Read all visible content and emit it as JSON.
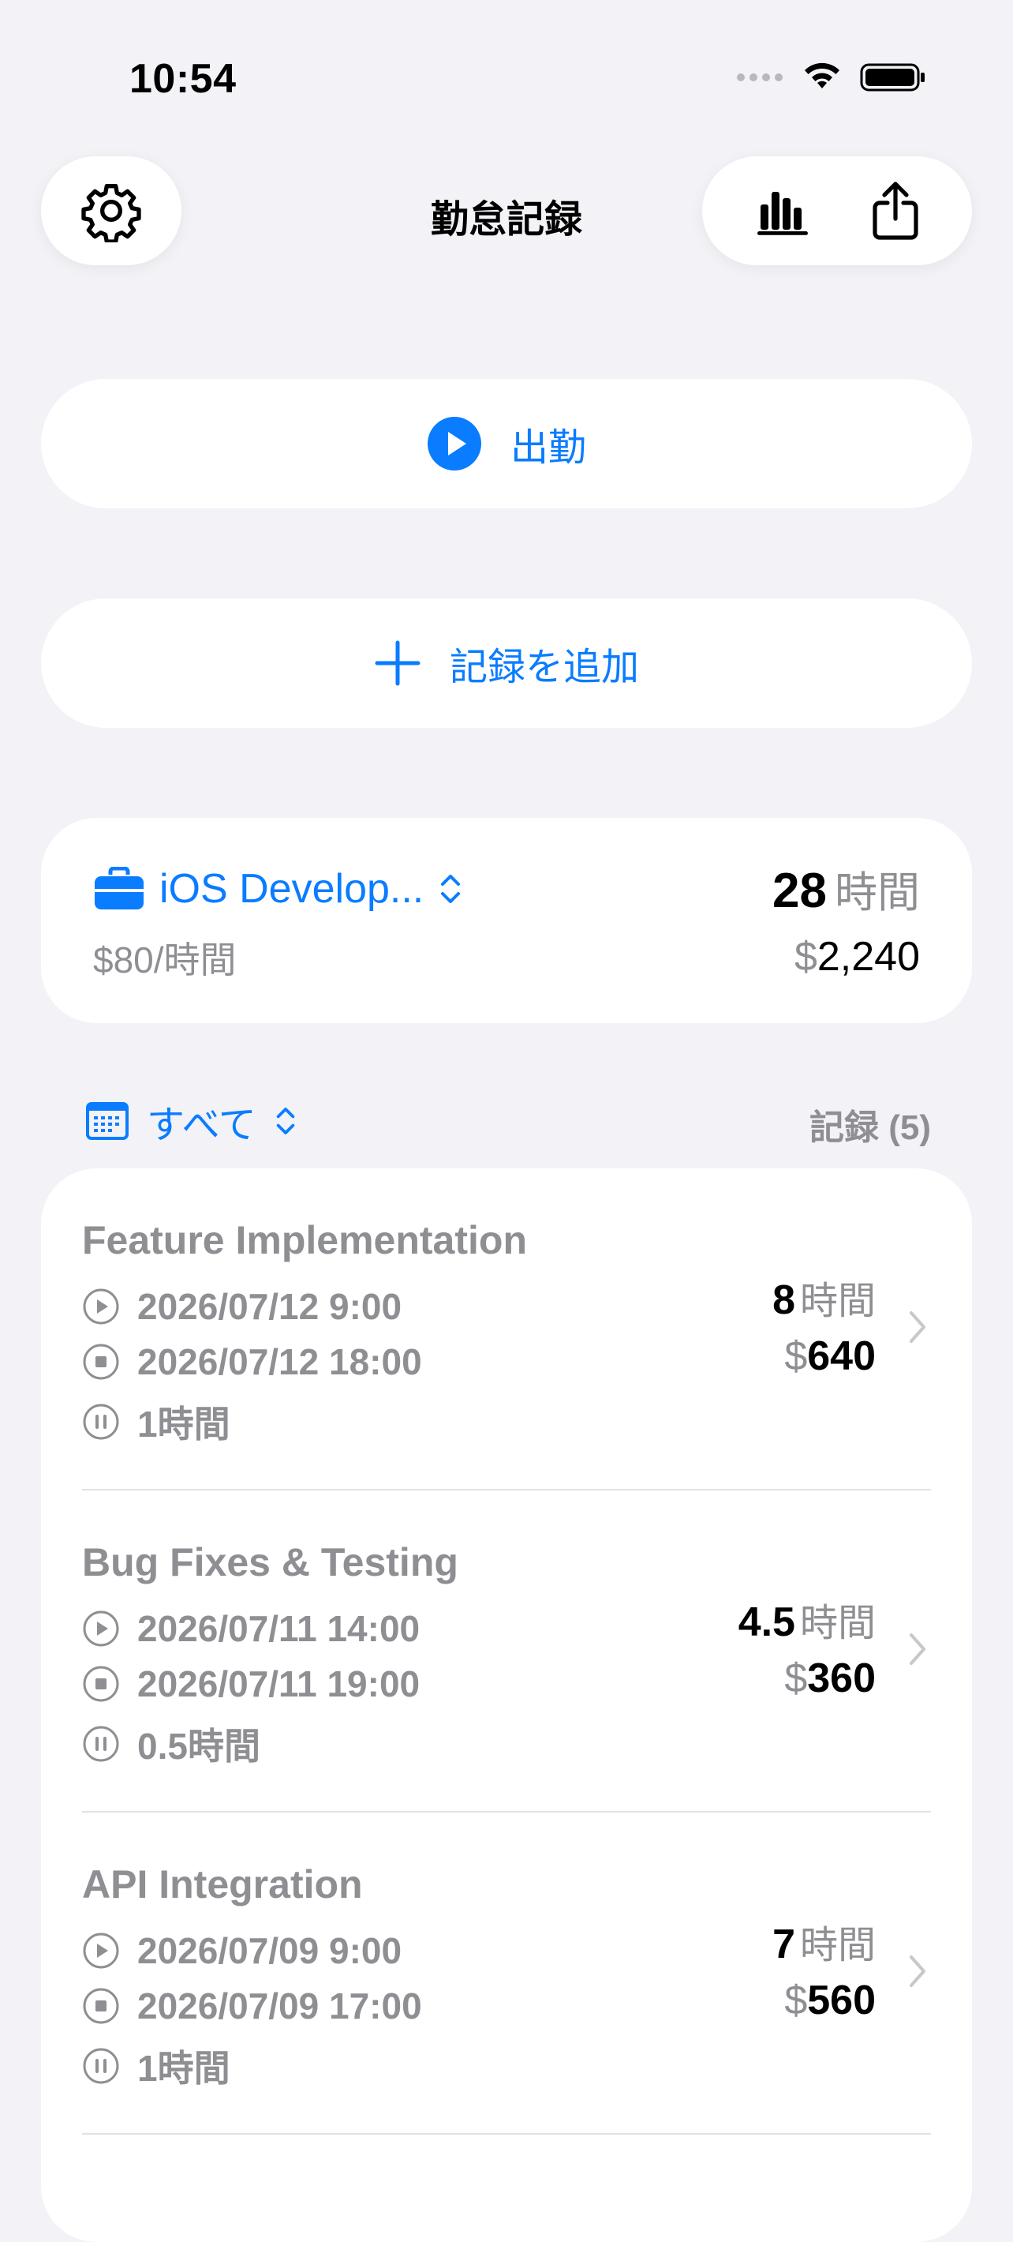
{
  "status_bar": {
    "time": "10:54"
  },
  "nav": {
    "title": "勤怠記録",
    "settings_icon": "gear-icon",
    "stats_icon": "chart-bar-icon",
    "share_icon": "share-icon"
  },
  "actions": {
    "clock_in_label": "出勤",
    "add_record_label": "記録を追加"
  },
  "summary": {
    "project_name": "iOS Develop...",
    "rate": "$80/時間",
    "total_hours": "28",
    "hours_unit": "時間",
    "currency": "$",
    "total_amount": "2,240"
  },
  "filter": {
    "label": "すべて",
    "records_count": "記録 (5)"
  },
  "records": [
    {
      "title": "Feature Implementation",
      "start": "2026/07/12 9:00",
      "end": "2026/07/12 18:00",
      "break": "1時間",
      "hours": "8",
      "hours_unit": "時間",
      "currency": "$",
      "amount": "640"
    },
    {
      "title": "Bug Fixes & Testing",
      "start": "2026/07/11 14:00",
      "end": "2026/07/11 19:00",
      "break": "0.5時間",
      "hours": "4.5",
      "hours_unit": "時間",
      "currency": "$",
      "amount": "360"
    },
    {
      "title": "API Integration",
      "start": "2026/07/09 9:00",
      "end": "2026/07/09 17:00",
      "break": "1時間",
      "hours": "7",
      "hours_unit": "時間",
      "currency": "$",
      "amount": "560"
    }
  ],
  "colors": {
    "accent": "#0A7CFF",
    "background": "#F2F2F7",
    "secondary_text": "#8E8E93"
  }
}
